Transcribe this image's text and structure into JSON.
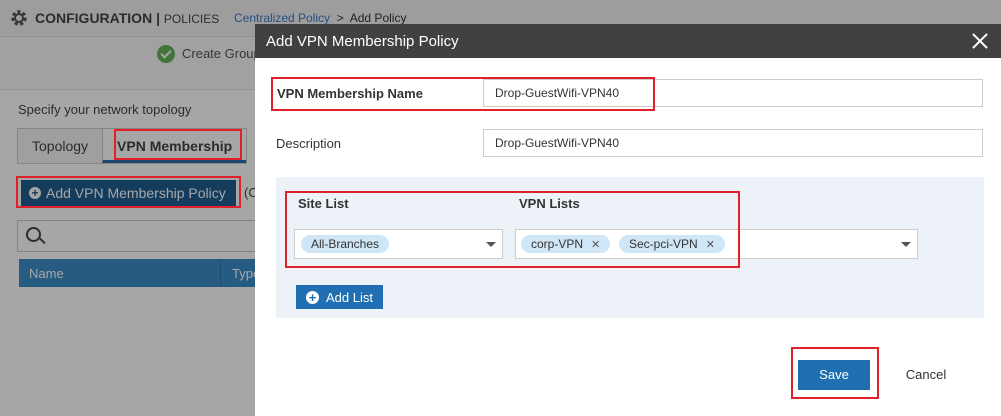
{
  "background": {
    "header": {
      "title": "CONFIGURATION",
      "separator": " | ",
      "section": "POLICIES",
      "breadcrumb_link": "Centralized Policy",
      "breadcrumb_sep": ">",
      "breadcrumb_current": "Add Policy"
    },
    "step_label": "Create Group",
    "topology_prompt": "Specify your network topology",
    "tabs": [
      "Topology",
      "VPN Membership"
    ],
    "add_button_label": "Add VPN Membership Policy",
    "paren_text": "(C",
    "table_headers": [
      "Name",
      "Type"
    ]
  },
  "modal": {
    "title": "Add VPN Membership Policy",
    "name_label": "VPN Membership Name",
    "name_value": "Drop-GuestWifi-VPN40",
    "description_label": "Description",
    "description_value": "Drop-GuestWifi-VPN40",
    "site_list_label": "Site List",
    "site_list_values": [
      "All-Branches"
    ],
    "vpn_lists_label": "VPN Lists",
    "vpn_lists_values": [
      "corp-VPN",
      "Sec-pci-VPN"
    ],
    "add_list_label": "Add List",
    "save_label": "Save",
    "cancel_label": "Cancel"
  },
  "colors": {
    "header_bg": "#414141",
    "primary_button": "#1f6fb2",
    "highlight": "#e0202a",
    "chip_bg": "#cfe6f7",
    "panel_bg": "#edf2f8"
  }
}
